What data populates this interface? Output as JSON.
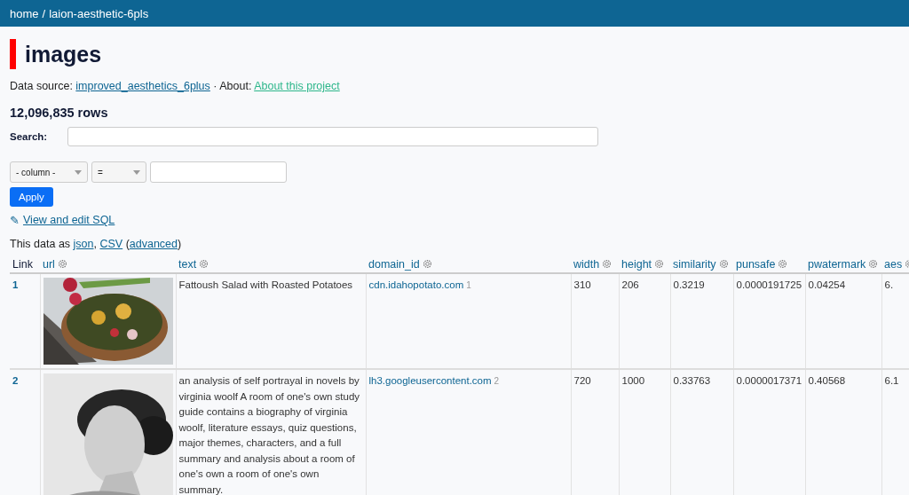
{
  "breadcrumb": {
    "home": "home",
    "separator": "/",
    "database": "laion-aesthetic-6pls"
  },
  "title": "images",
  "metadata": [
    {
      "kind": "text",
      "text": "Data source: "
    },
    {
      "kind": "link",
      "text": "improved_aesthetics_6plus"
    },
    {
      "kind": "text",
      "text": " · About: "
    },
    {
      "kind": "about",
      "text": "About this project"
    }
  ],
  "row_count": "12,096,835 rows",
  "search": {
    "label": "Search:"
  },
  "filter": {
    "column": "- column -",
    "operator": "="
  },
  "apply_button": "Apply",
  "sql_link": {
    "icon": "✎",
    "label": "View and edit SQL"
  },
  "export": [
    {
      "kind": "text",
      "text": "This data as "
    },
    {
      "kind": "link",
      "text": "json"
    },
    {
      "kind": "text",
      "text": ", "
    },
    {
      "kind": "link",
      "text": "CSV"
    },
    {
      "kind": "text",
      "text": " ("
    },
    {
      "kind": "link",
      "text": "advanced"
    },
    {
      "kind": "text",
      "text": ")"
    }
  ],
  "table": {
    "columns": [
      {
        "label": "Link",
        "kind": "plain"
      },
      {
        "label": "url",
        "kind": "column"
      },
      {
        "label": "text",
        "kind": "column"
      },
      {
        "label": "domain_id",
        "kind": "column"
      },
      {
        "label": "width",
        "kind": "column"
      },
      {
        "label": "height",
        "kind": "column"
      },
      {
        "label": "similarity",
        "kind": "column"
      },
      {
        "label": "punsafe",
        "kind": "column"
      },
      {
        "label": "pwatermark",
        "kind": "column"
      },
      {
        "label": "aes",
        "kind": "column"
      }
    ],
    "rows": [
      {
        "link": "1",
        "image": {
          "kind": "picture"
        },
        "text": "Fattoush Salad with Roasted Potatoes",
        "domain": "cdn.idahopotato.com",
        "domain_id": "1",
        "values": [
          "310",
          "206",
          "0.3219",
          "0.0000191725",
          "0.04254",
          "6."
        ]
      },
      {
        "link": "2",
        "image": {
          "kind": "picture"
        },
        "text": "an analysis of self portrayal in novels by virginia woolf A room of one's own study guide contains a biography of virginia woolf, literature essays, quiz questions, major themes, characters, and a full summary and analysis about a room of one's own a room of one's own summary.",
        "domain": "lh3.googleusercontent.com",
        "domain_id": "2",
        "values": [
          "720",
          "1000",
          "0.33763",
          "0.0000017371",
          "0.40568",
          "6.1"
        ]
      }
    ]
  }
}
